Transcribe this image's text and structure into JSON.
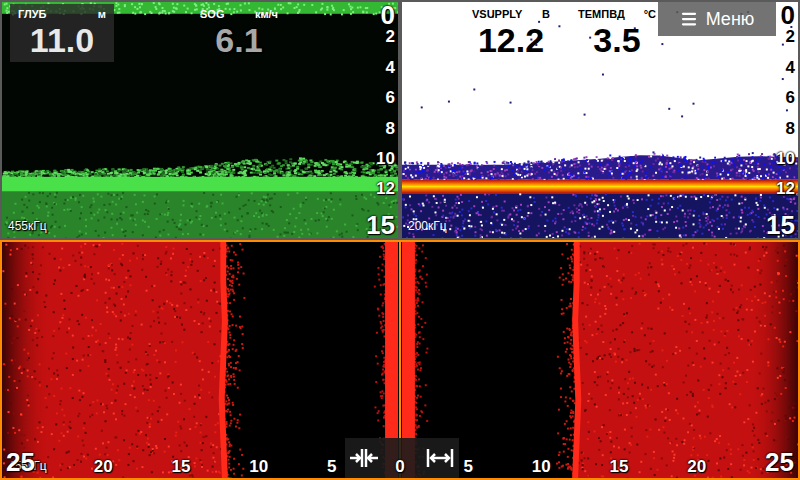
{
  "panels": [
    {
      "name": "sonar-455",
      "frequency": "455кГц",
      "active": false,
      "scale": [
        "0",
        "2",
        "4",
        "6",
        "8",
        "10",
        "12",
        "15"
      ],
      "readouts": [
        {
          "label": "ГЛУБ",
          "unit": "м",
          "value": "11.0",
          "kind": "boxed"
        },
        {
          "label": "SOG",
          "unit": "км/ч",
          "value": "6.1",
          "kind": "plain"
        }
      ],
      "bottom_profile": [
        10.9,
        10.8,
        10.7,
        10.7,
        10.5,
        10.1,
        10.0,
        10.2,
        10.3
      ]
    },
    {
      "name": "sonar-200",
      "frequency": "200кГц",
      "active": false,
      "scale": [
        "0",
        "2",
        "4",
        "6",
        "8",
        "10",
        "12",
        "15"
      ],
      "readouts": [
        {
          "label": "VSUPPLY",
          "unit": "В",
          "value": "12.2",
          "kind": "plain"
        },
        {
          "label": "ТЕМПВД",
          "unit": "°C",
          "value": "3.5",
          "kind": "plain"
        }
      ],
      "menu": {
        "label": "Меню"
      },
      "bottom_profile": [
        10.5,
        10.5,
        10.5,
        10.3,
        10.1,
        9.8,
        10.2,
        9.9,
        10.0
      ]
    }
  ],
  "sidescan": {
    "frequency": "455кГц",
    "active": true,
    "scale": [
      "25",
      "20",
      "15",
      "10",
      "5",
      "0",
      "5",
      "10",
      "15",
      "20",
      "25"
    ],
    "seabed_profile": [
      11.1,
      11.1,
      11.0,
      11.1,
      11.2,
      11.1,
      11.0
    ]
  }
}
